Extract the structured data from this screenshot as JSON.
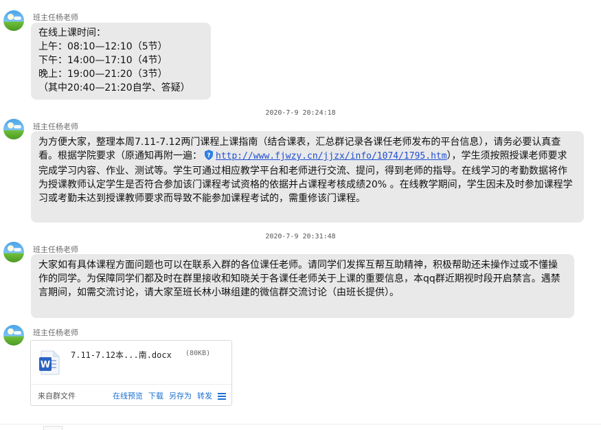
{
  "messages": [
    {
      "sender": "班主任杨老师",
      "lines": [
        "在线上课时间：",
        "上午：08:10—12:10（5节）",
        "下午：14:00—17:10（4节）",
        "晚上：19:00—21:20（3节）",
        "（其中20:40—21:20自学、答疑）"
      ]
    },
    {
      "timestamp": "2020-7-9 20:24:18",
      "sender": "班主任杨老师",
      "text_before_link": "为方便大家，整理本周7.11-7.12两门课程上课指南（结合课表，汇总群记录各课任老师发布的平台信息），请务必要认真查看。根据学院要求（原通知再附一遍：",
      "link": "http://www.fjwzy.cn/jjzx/info/1074/1795.htm",
      "text_after_link": "），学生须按照授课老师要求完成学习内容、作业、测试等。学生可通过相应教学平台和老师进行交流、提问，得到老师的指导。在线学习的考勤数据将作为授课教师认定学生是否符合参加该门课程考试资格的依据并占课程考核成绩20% 。在线教学期间，学生因未及时参加课程学习或考勤未达到授课教师要求而导致不能参加课程考试的，需重修该门课程。"
    },
    {
      "timestamp": "2020-7-9 20:31:48",
      "sender": "班主任杨老师",
      "text": "大家如有具体课程方面问题也可以在联系入群的各位课任老师。请同学们发挥互帮互助精神，积极帮助还未操作过或不懂操作的同学。为保障同学们都及时在群里接收和知晓关于各课任老师关于上课的重要信息，本qq群近期视时段开启禁言。遇禁言期间，如需交流讨论，请大家至班长林小琳组建的微信群交流讨论（由班长提供）。"
    },
    {
      "sender": "班主任杨老师",
      "file": {
        "name": "7.11-7.12本...南.docx",
        "size": "(80KB)",
        "source": "来自群文件",
        "actions": [
          "在线预览",
          "下载",
          "另存为",
          "转发"
        ],
        "icon": "word-doc-icon"
      }
    }
  ],
  "colors": {
    "bubble": "#e9e9e9",
    "link": "#1f4fd1",
    "action": "#1a6fd0"
  }
}
